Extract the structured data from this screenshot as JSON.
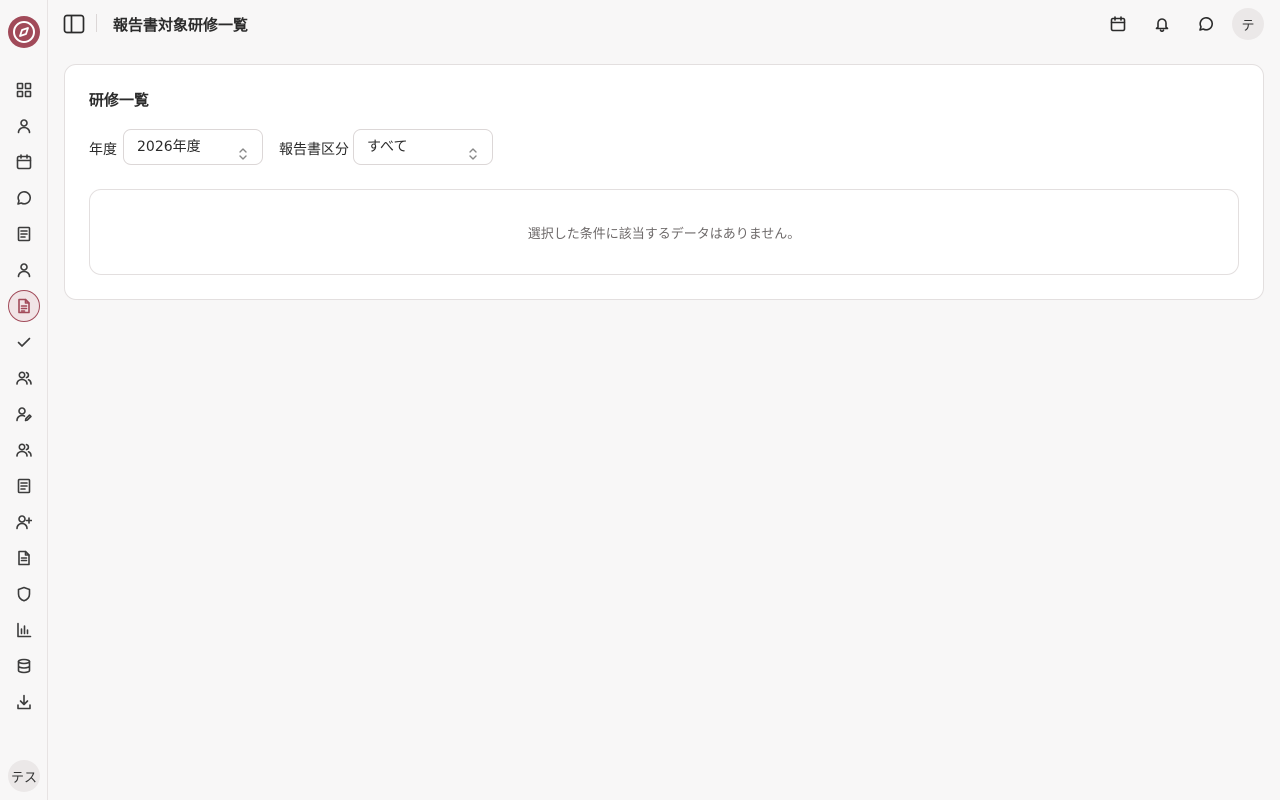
{
  "header": {
    "title": "報告書対象研修一覧",
    "avatar_initial": "テ"
  },
  "sidebar": {
    "user_initials": "テス",
    "accent": "#a14a59",
    "items": [
      {
        "icon": "dashboard-icon"
      },
      {
        "icon": "user-icon"
      },
      {
        "icon": "calendar-icon"
      },
      {
        "icon": "message-icon"
      },
      {
        "icon": "notebook-icon"
      },
      {
        "icon": "user-icon"
      },
      {
        "icon": "report-document-icon",
        "active": true
      },
      {
        "icon": "check-icon"
      },
      {
        "icon": "users-icon"
      },
      {
        "icon": "user-edit-icon"
      },
      {
        "icon": "users-icon"
      },
      {
        "icon": "notebook-icon"
      },
      {
        "icon": "user-plus-icon"
      },
      {
        "icon": "document-icon"
      },
      {
        "icon": "shield-icon"
      },
      {
        "icon": "bar-chart-icon"
      },
      {
        "icon": "database-icon"
      },
      {
        "icon": "download-icon"
      }
    ]
  },
  "main": {
    "card_title": "研修一覧",
    "filters": {
      "year_label": "年度",
      "year_value": "2026年度",
      "report_type_label": "報告書区分",
      "report_type_value": "すべて"
    },
    "empty_message": "選択した条件に該当するデータはありません。"
  }
}
